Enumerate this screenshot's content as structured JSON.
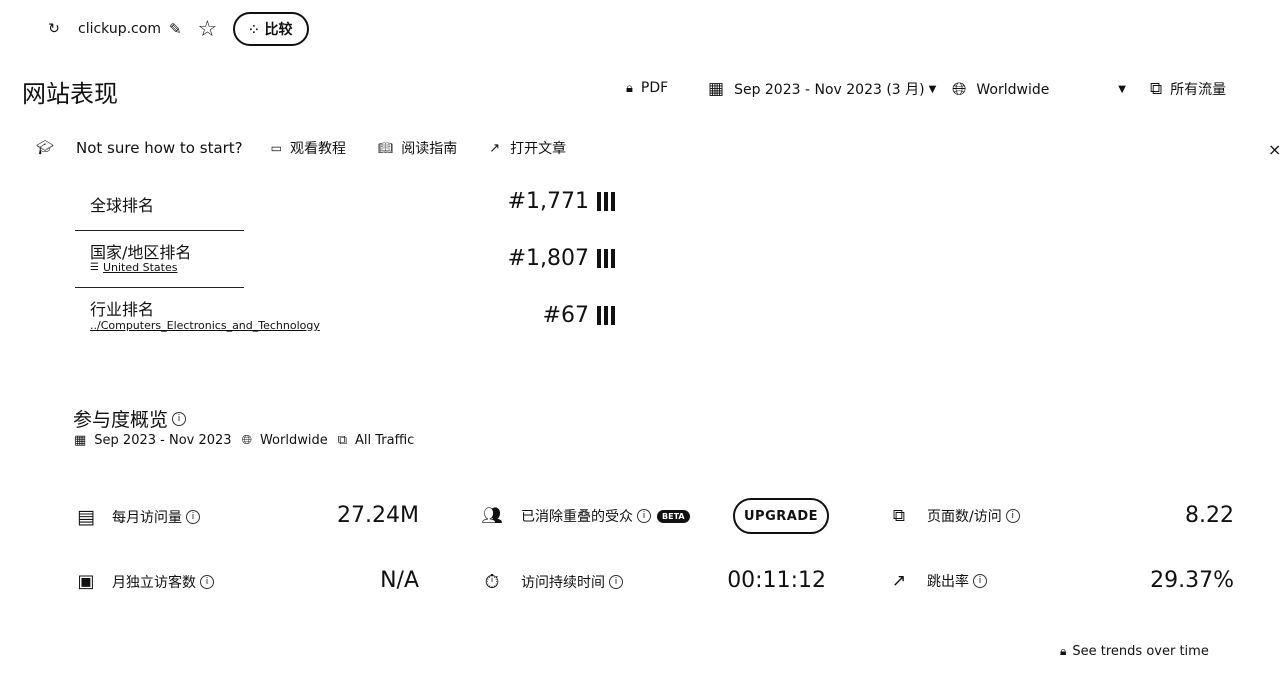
{
  "topbar": {
    "domain": "clickup.com",
    "compare_label": "比较"
  },
  "header": {
    "title": "网站表现",
    "pdf_label": "PDF",
    "date_range": "Sep 2023 - Nov 2023 (3 月)",
    "region": "Worldwide",
    "traffic": "所有流量"
  },
  "helpbar": {
    "prompt": "Not sure how to start?",
    "watch": "观看教程",
    "read": "阅读指南",
    "open": "打开文章"
  },
  "ranks": [
    {
      "label": "全球排名",
      "sub": "",
      "value": "#1,771"
    },
    {
      "label": "国家/地区排名",
      "sub": "United States",
      "value": "#1,807"
    },
    {
      "label": "行业排名",
      "sub": "../Computers_Electronics_and_Technology",
      "value": "#67"
    }
  ],
  "engagement": {
    "title": "参与度概览",
    "date": "Sep 2023 - Nov 2023",
    "region": "Worldwide",
    "traffic": "All Traffic"
  },
  "metrics": {
    "monthly_visits": {
      "label": "每月访问量",
      "value": "27.24M"
    },
    "dedup_audience": {
      "label": "已消除重叠的受众",
      "badge": "BETA",
      "button": "UPGRADE"
    },
    "pages_per_visit": {
      "label": "页面数/访问",
      "value": "8.22"
    },
    "unique_visitors": {
      "label": "月独立访客数",
      "value": "N/A"
    },
    "visit_duration": {
      "label": "访问持续时间",
      "value": "00:11:12"
    },
    "bounce_rate": {
      "label": "跳出率",
      "value": "29.37%"
    }
  },
  "footer": {
    "trends": "See trends over time"
  }
}
